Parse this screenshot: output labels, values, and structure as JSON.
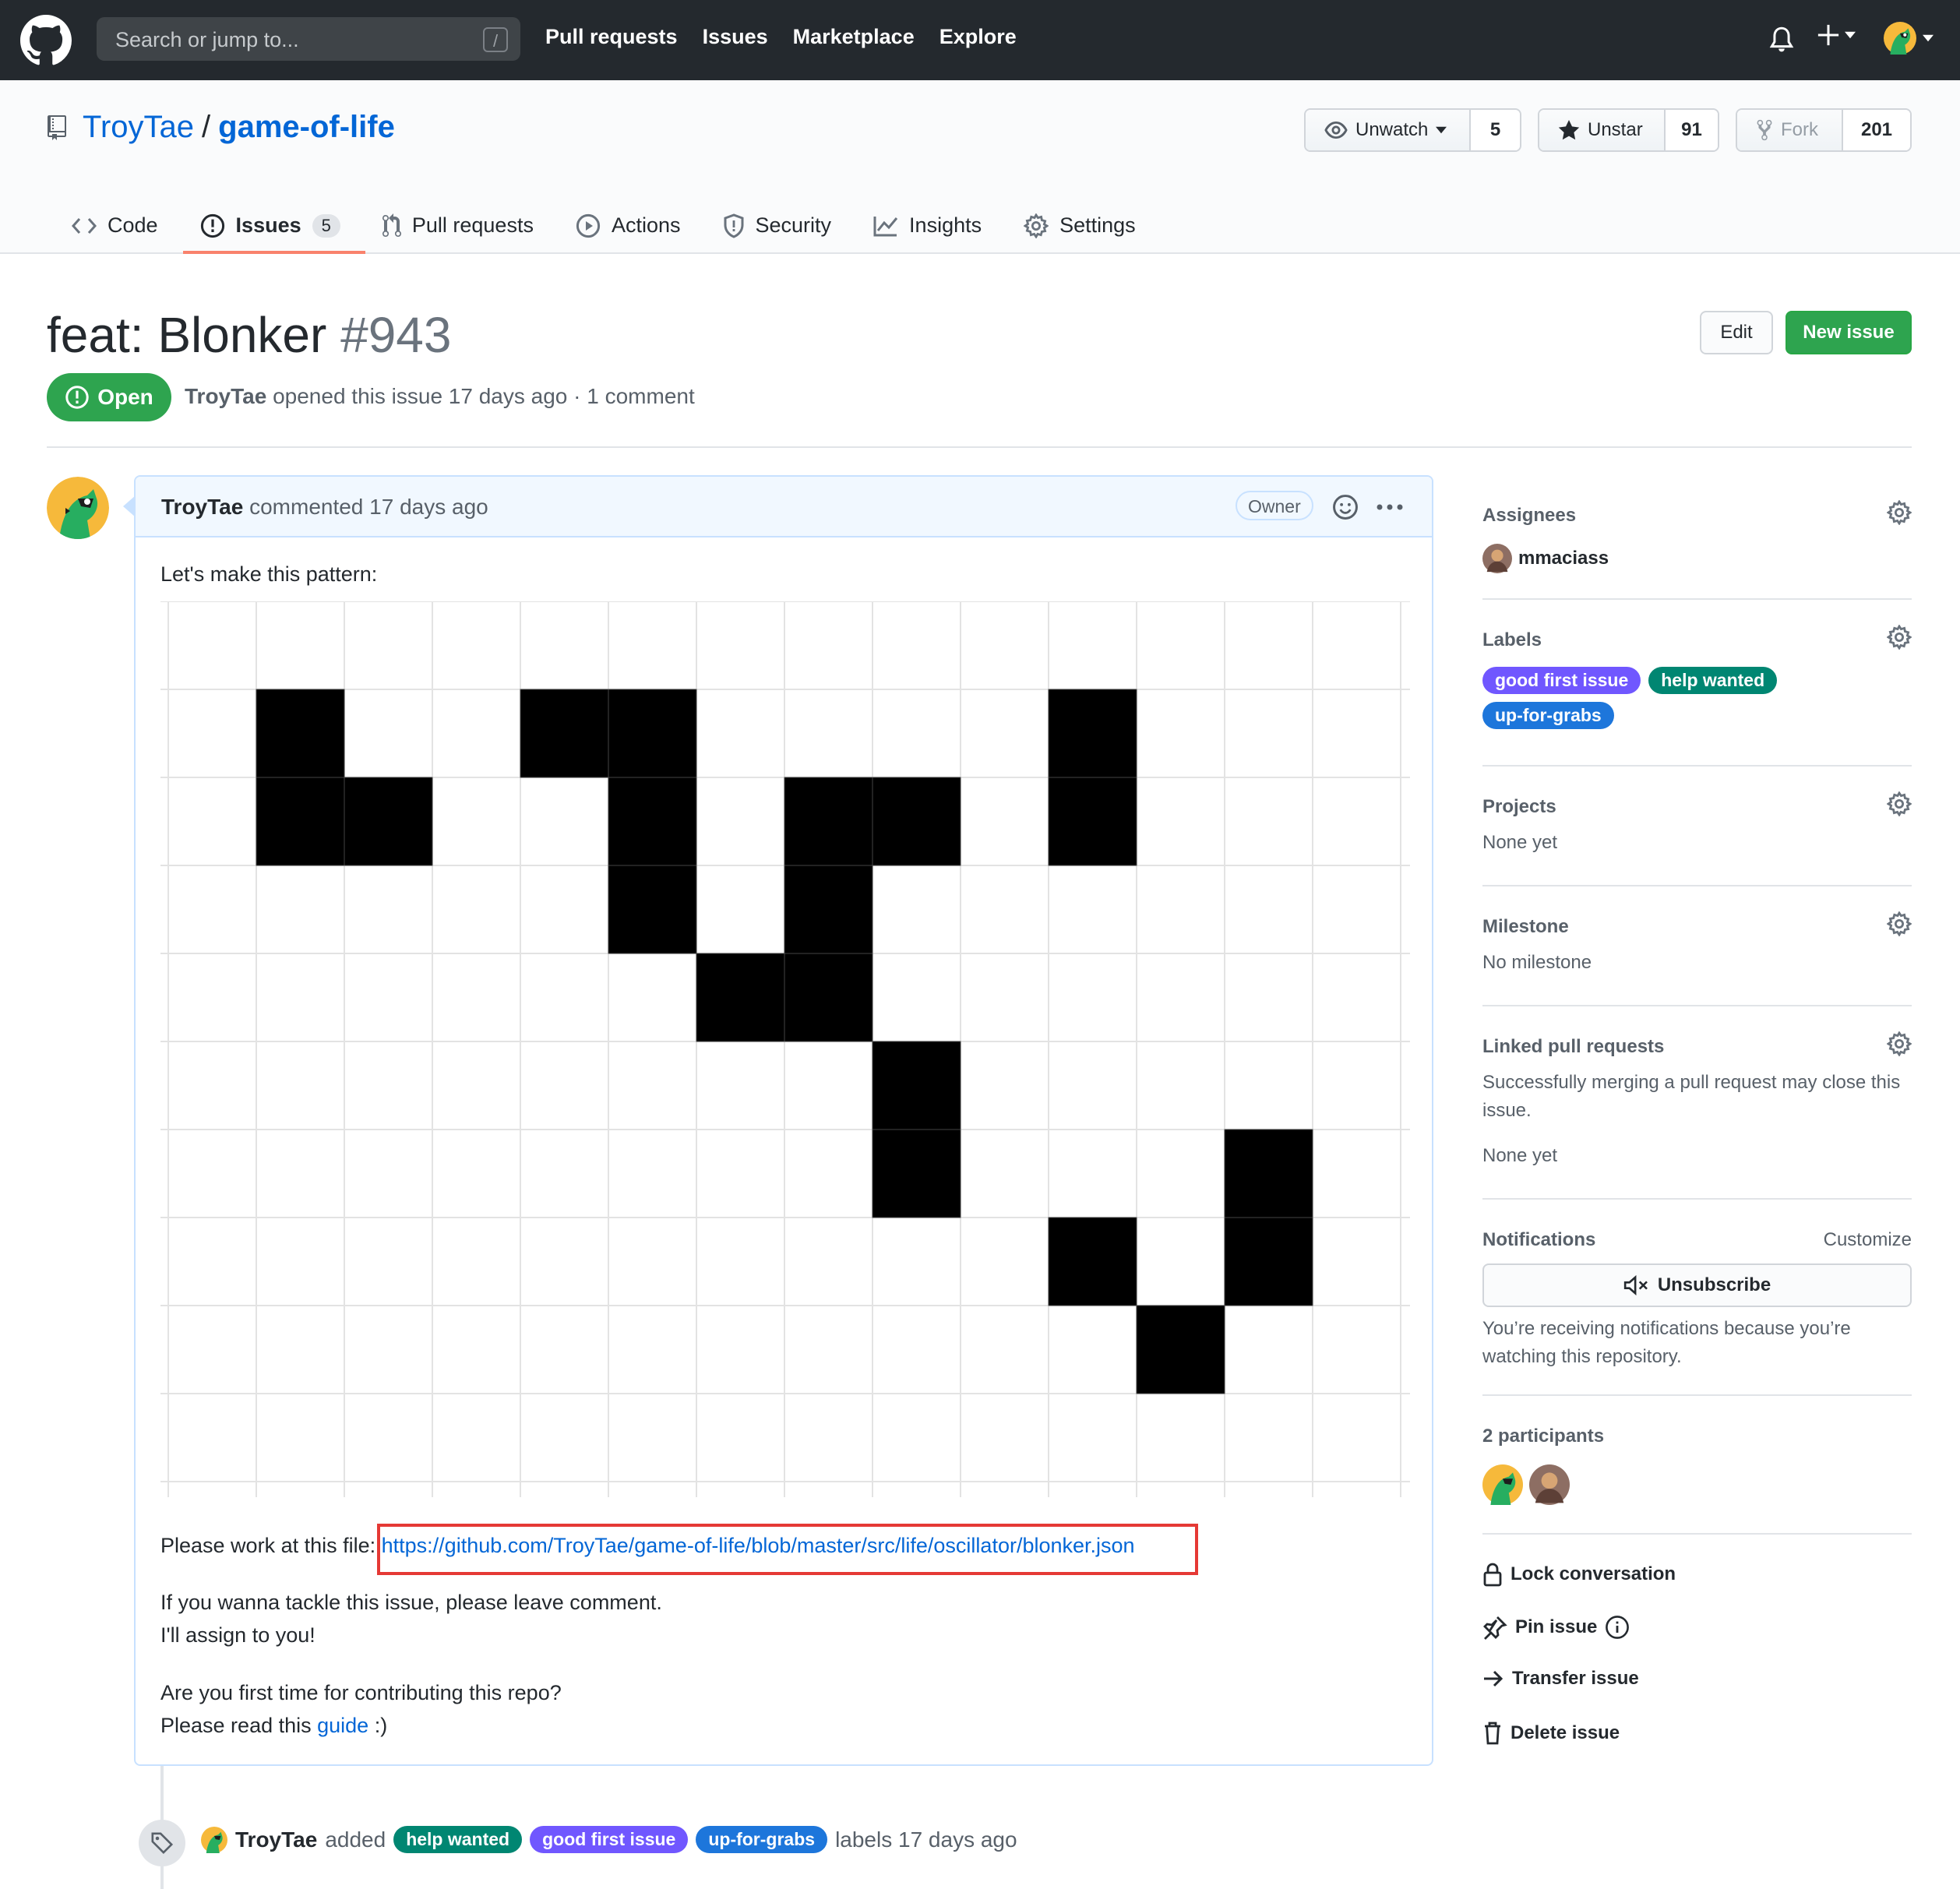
{
  "header": {
    "search_placeholder": "Search or jump to...",
    "search_shortcut": "/",
    "nav": [
      "Pull requests",
      "Issues",
      "Marketplace",
      "Explore"
    ]
  },
  "repo": {
    "owner": "TroyTae",
    "separator": "/",
    "name": "game-of-life",
    "watch": {
      "label": "Unwatch",
      "count": "5"
    },
    "star": {
      "label": "Unstar",
      "count": "91"
    },
    "fork": {
      "label": "Fork",
      "count": "201"
    },
    "tabs": [
      {
        "label": "Code",
        "icon": "code-icon"
      },
      {
        "label": "Issues",
        "icon": "issue-opened-icon",
        "counter": "5",
        "selected": true
      },
      {
        "label": "Pull requests",
        "icon": "git-pull-request-icon"
      },
      {
        "label": "Actions",
        "icon": "play-icon"
      },
      {
        "label": "Security",
        "icon": "shield-icon"
      },
      {
        "label": "Insights",
        "icon": "graph-icon"
      },
      {
        "label": "Settings",
        "icon": "gear-icon"
      }
    ]
  },
  "issue": {
    "title": "feat: Blonker",
    "number": "#943",
    "state": "Open",
    "author": "TroyTae",
    "opened_text": "opened this issue 17 days ago · 1 comment",
    "edit_label": "Edit",
    "new_issue_label": "New issue"
  },
  "comment": {
    "author": "TroyTae",
    "action": "commented 17 days ago",
    "role": "Owner",
    "intro": "Let's make this pattern:",
    "grid": {
      "columns": 14,
      "rows": 10,
      "filled": [
        [
          1,
          1
        ],
        [
          4,
          1
        ],
        [
          5,
          1
        ],
        [
          10,
          1
        ],
        [
          1,
          2
        ],
        [
          2,
          2
        ],
        [
          5,
          2
        ],
        [
          7,
          2
        ],
        [
          8,
          2
        ],
        [
          10,
          2
        ],
        [
          5,
          3
        ],
        [
          7,
          3
        ],
        [
          6,
          4
        ],
        [
          7,
          4
        ],
        [
          8,
          5
        ],
        [
          8,
          6
        ],
        [
          12,
          6
        ],
        [
          10,
          7
        ],
        [
          12,
          7
        ],
        [
          11,
          8
        ]
      ]
    },
    "file_prefix": "Please work at this file:",
    "file_link": "https://github.com/TroyTae/game-of-life/blob/master/src/life/oscillator/blonker.json",
    "line1": "If you wanna tackle this issue, please leave comment.",
    "line2": "I'll assign to you!",
    "line3": "Are you first time for contributing this repo?",
    "line4_prefix": "Please read this ",
    "line4_link": "guide",
    "line4_suffix": " :)"
  },
  "timeline_event": {
    "author": "TroyTae",
    "action": "added",
    "labels": [
      {
        "name": "help wanted",
        "color": "#008672"
      },
      {
        "name": "good first issue",
        "color": "#7057ff"
      },
      {
        "name": "up-for-grabs",
        "color": "#1d76db"
      }
    ],
    "suffix": "labels 17 days ago"
  },
  "sidebar": {
    "assignees_heading": "Assignees",
    "assignee": "mmaciass",
    "labels_heading": "Labels",
    "labels": [
      {
        "name": "good first issue",
        "color": "#7057ff"
      },
      {
        "name": "help wanted",
        "color": "#008672"
      },
      {
        "name": "up-for-grabs",
        "color": "#1d76db"
      }
    ],
    "projects_heading": "Projects",
    "projects_value": "None yet",
    "milestone_heading": "Milestone",
    "milestone_value": "No milestone",
    "linked_heading": "Linked pull requests",
    "linked_note_1": "Successfully merging a pull request may close this",
    "linked_note_2": "issue.",
    "linked_value": "None yet",
    "notifications_heading": "Notifications",
    "customize": "Customize",
    "unsubscribe": "Unsubscribe",
    "notif_note_1": "You’re receiving notifications because you’re",
    "notif_note_2": "watching this repository.",
    "participants_heading": "2 participants",
    "actions": [
      "Lock conversation",
      "Pin issue",
      "Transfer issue",
      "Delete issue"
    ]
  }
}
